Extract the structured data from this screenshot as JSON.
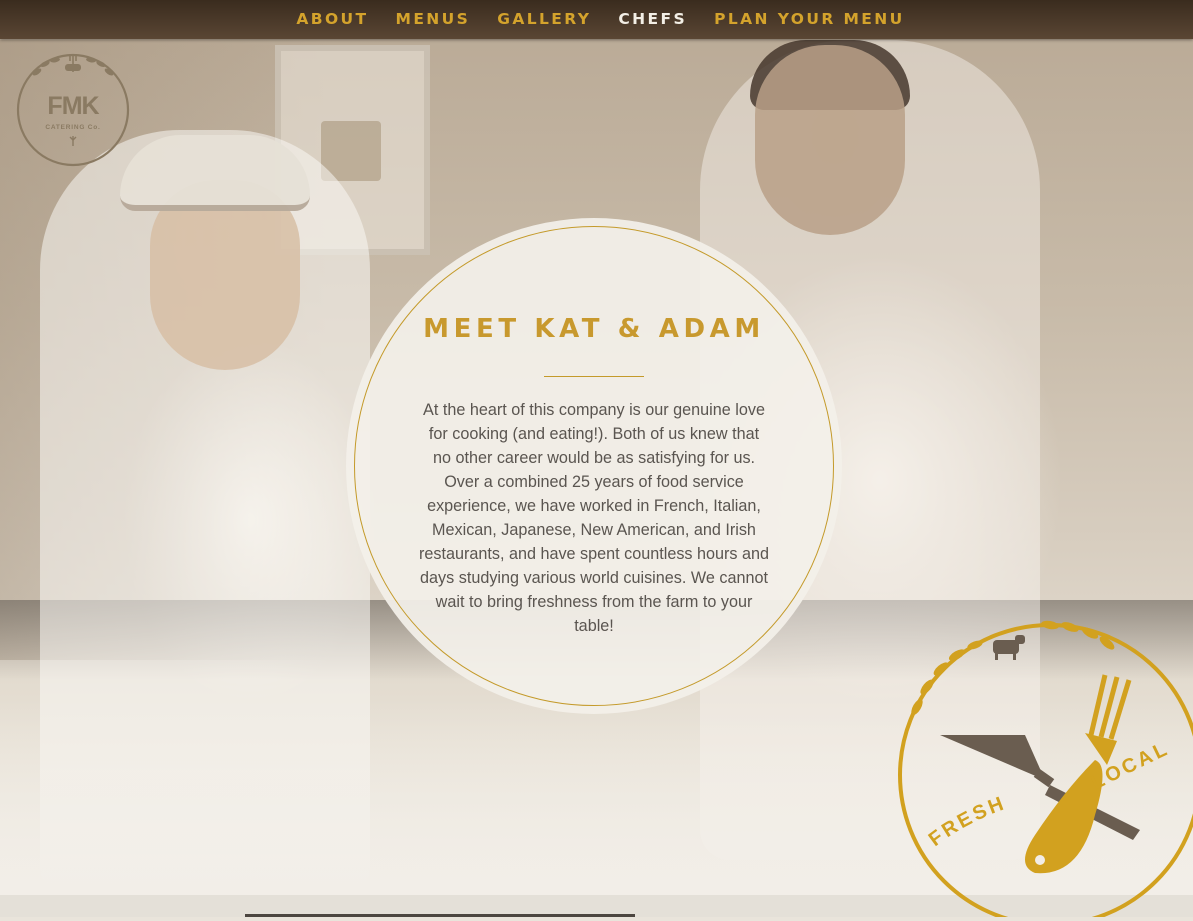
{
  "nav": {
    "items": [
      {
        "label": "ABOUT"
      },
      {
        "label": "MENUS"
      },
      {
        "label": "GALLERY"
      },
      {
        "label": "CHEFS",
        "active": true
      },
      {
        "label": "PLAN YOUR MENU"
      }
    ]
  },
  "logo": {
    "text": "FMK",
    "subtext": "CATERING Co."
  },
  "intro": {
    "heading": "MEET KAT & ADAM",
    "body": "At the heart of this company is our genuine love for cooking (and eating!). Both of us knew that no other career would be as satisfying for us. Over a combined 25 years of food service experience, we have worked in French, Italian, Mexican, Japanese, New American, and Irish restaurants, and have spent countless hours and days studying various world cuisines. We cannot wait to bring freshness from the farm to your table!"
  },
  "badge": {
    "word_left": "FRESH",
    "word_right": "LOCAL"
  },
  "colors": {
    "gold": "#c8992e",
    "nav_bg": "#4a3828",
    "active_nav": "#f3efe6",
    "logo_brown": "#8a7a62"
  }
}
